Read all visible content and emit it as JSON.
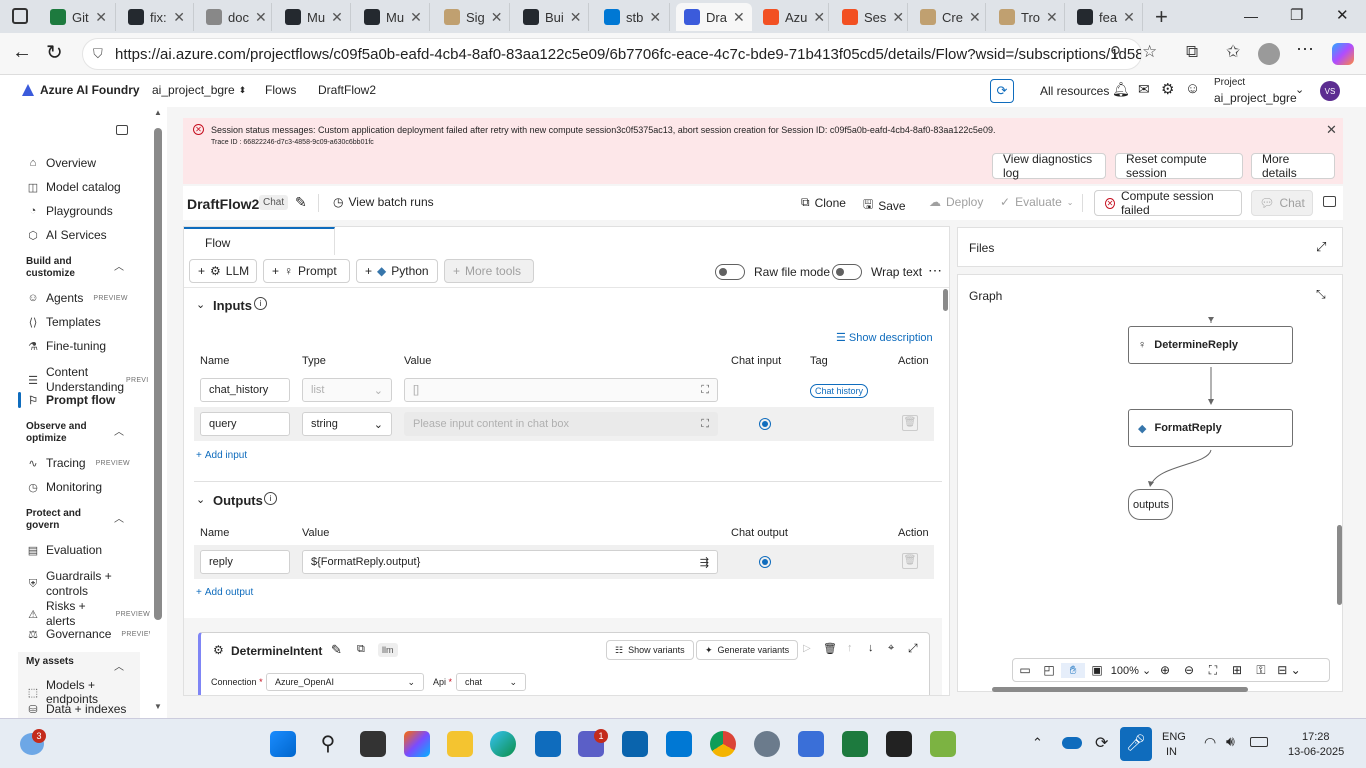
{
  "browser": {
    "tabs": [
      {
        "label": "Git",
        "color": "#1d7a3e"
      },
      {
        "label": "fix:",
        "color": "#24292f"
      },
      {
        "label": "doc",
        "color": "#888888"
      },
      {
        "label": "Mu",
        "color": "#24292f"
      },
      {
        "label": "Mu",
        "color": "#24292f"
      },
      {
        "label": "Sig",
        "color": "#c0a070"
      },
      {
        "label": "Bui",
        "color": "#24292f"
      },
      {
        "label": "stb",
        "color": "#0078d4"
      },
      {
        "label": "Dra",
        "color": "#3b5bdb"
      },
      {
        "label": "Azu",
        "color": "#f25022"
      },
      {
        "label": "Ses",
        "color": "#f25022"
      },
      {
        "label": "Cre",
        "color": "#c0a070"
      },
      {
        "label": "Tro",
        "color": "#c0a070"
      },
      {
        "label": "fea",
        "color": "#24292f"
      }
    ],
    "url": "https://ai.azure.com/projectflows/c09f5a0b-eafd-4cb4-8af0-83aa122c5e09/6b7706fc-eace-4c7c-bde9-71b413f05cd5/details/Flow?wsid=/subscriptions/1d587...",
    "new_tab": "+",
    "minimize": "—",
    "restore": "❐",
    "close": "✕"
  },
  "header": {
    "brand": "Azure AI Foundry",
    "project_crumb": "ai_project_bgre",
    "flows_crumb": "Flows",
    "current_crumb": "DraftFlow2",
    "all_resources": "All resources",
    "project_label": "Project",
    "project_name": "ai_project_bgre",
    "avatar": "VS"
  },
  "sidebar": {
    "items": [
      {
        "label": "Overview",
        "icon": "⌂"
      },
      {
        "label": "Model catalog",
        "icon": "◫"
      },
      {
        "label": "Playgrounds",
        "icon": "◔"
      },
      {
        "label": "AI Services",
        "icon": "⬡"
      }
    ],
    "section_build": "Build and customize",
    "build_items": [
      {
        "label": "Agents",
        "badge": "PREVIEW",
        "icon": "☺"
      },
      {
        "label": "Templates",
        "icon": "⟨⟩"
      },
      {
        "label": "Fine-tuning",
        "icon": "⚗"
      },
      {
        "label": "Content Understanding",
        "badge": "PREVI",
        "icon": "☰"
      },
      {
        "label": "Prompt flow",
        "icon": "⚐"
      }
    ],
    "section_observe": "Observe and optimize",
    "observe_items": [
      {
        "label": "Tracing",
        "badge": "PREVIEW",
        "icon": "∿"
      },
      {
        "label": "Monitoring",
        "icon": "◷"
      }
    ],
    "section_protect": "Protect and govern",
    "protect_items": [
      {
        "label": "Evaluation",
        "icon": "▤"
      },
      {
        "label": "Guardrails + controls",
        "icon": "⛨"
      },
      {
        "label": "Risks + alerts",
        "badge": "PREVIEW",
        "icon": "⚠"
      },
      {
        "label": "Governance",
        "badge": "PREVIEW",
        "icon": "⚖"
      }
    ],
    "section_assets": "My assets",
    "asset_items": [
      {
        "label": "Models + endpoints",
        "icon": "⬚"
      },
      {
        "label": "Data + indexes",
        "icon": "⛁"
      }
    ]
  },
  "banner": {
    "message": "Session status messages: Custom application deployment failed after retry with new compute session3c0f5375ac13, abort session creation for Session ID: c09f5a0b-eafd-4cb4-8af0-83aa122c5e09.",
    "trace": "Trace ID : 66822246-d7c3-4858-9c09-a630c6bb01fc",
    "btn_diagnostics": "View diagnostics log",
    "btn_reset": "Reset compute session",
    "btn_more": "More details"
  },
  "toolbar": {
    "title": "DraftFlow2",
    "badge": "Chat",
    "batch_runs": "View batch runs",
    "clone": "Clone",
    "save": "Save",
    "deploy": "Deploy",
    "evaluate": "Evaluate",
    "compute_status": "Compute session failed",
    "chat": "Chat"
  },
  "flow": {
    "tab": "Flow",
    "tools": [
      "LLM",
      "Prompt",
      "Python",
      "More tools"
    ],
    "raw_file_mode": "Raw file mode",
    "wrap_text": "Wrap text",
    "inputs_title": "Inputs",
    "show_description": "Show description",
    "input_cols": [
      "Name",
      "Type",
      "Value",
      "Chat input",
      "Tag",
      "Action"
    ],
    "input_rows": [
      {
        "name": "chat_history",
        "type": "list",
        "value": "[]",
        "tag": "Chat history"
      },
      {
        "name": "query",
        "type": "string",
        "value": "Please input content in chat box"
      }
    ],
    "add_input": "Add input",
    "outputs_title": "Outputs",
    "output_cols": [
      "Name",
      "Value",
      "Chat output",
      "Action"
    ],
    "output_rows": [
      {
        "name": "reply",
        "value": "${FormatReply.output}"
      }
    ],
    "add_output": "Add output",
    "node": {
      "name": "DetermineIntent",
      "type": "llm",
      "show_variants": "Show variants",
      "generate_variants": "Generate variants",
      "connection_label": "Connection",
      "connection_value": "Azure_OpenAI",
      "api_label": "Api",
      "api_value": "chat"
    }
  },
  "files": {
    "title": "Files"
  },
  "graph": {
    "title": "Graph",
    "nodes": [
      "DetermineReply",
      "FormatReply",
      "outputs"
    ],
    "zoom": "100%"
  },
  "taskbar": {
    "lang": "ENG",
    "region": "IN",
    "time": "17:28",
    "date": "13-06-2025",
    "weather_badge": "3",
    "teams_badge": "1"
  }
}
